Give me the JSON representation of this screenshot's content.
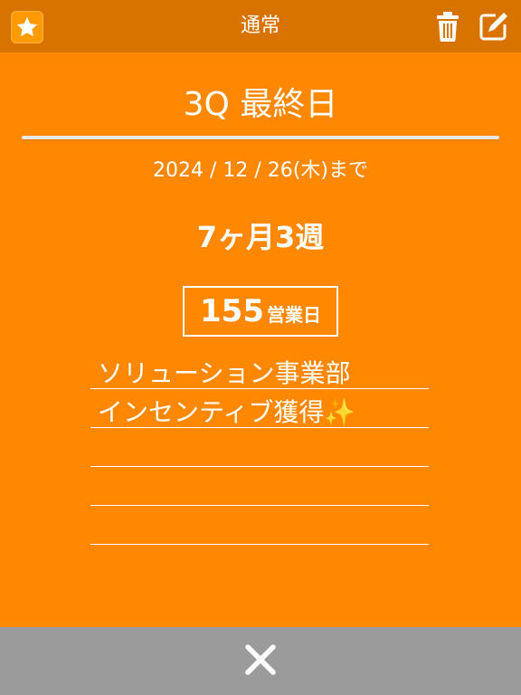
{
  "header": {
    "title": "通常",
    "star_icon": "star-icon",
    "trash_icon": "trash-icon",
    "edit_icon": "edit-icon"
  },
  "event": {
    "title": "3Q  最終日",
    "deadline": "2024 / 12 / 26(木)まで",
    "remaining": "7ヶ月3週",
    "business_days_count": "155",
    "business_days_unit": "営業日"
  },
  "memo": {
    "lines": [
      "ソリューション事業部",
      "インセンティブ獲得✨",
      "",
      "",
      ""
    ]
  },
  "footer": {
    "close_icon": "close-icon"
  },
  "colors": {
    "background": "#ff8800",
    "header_bar": "#d97300",
    "footer_bar": "#9b9b9b",
    "text": "#ffffff"
  }
}
